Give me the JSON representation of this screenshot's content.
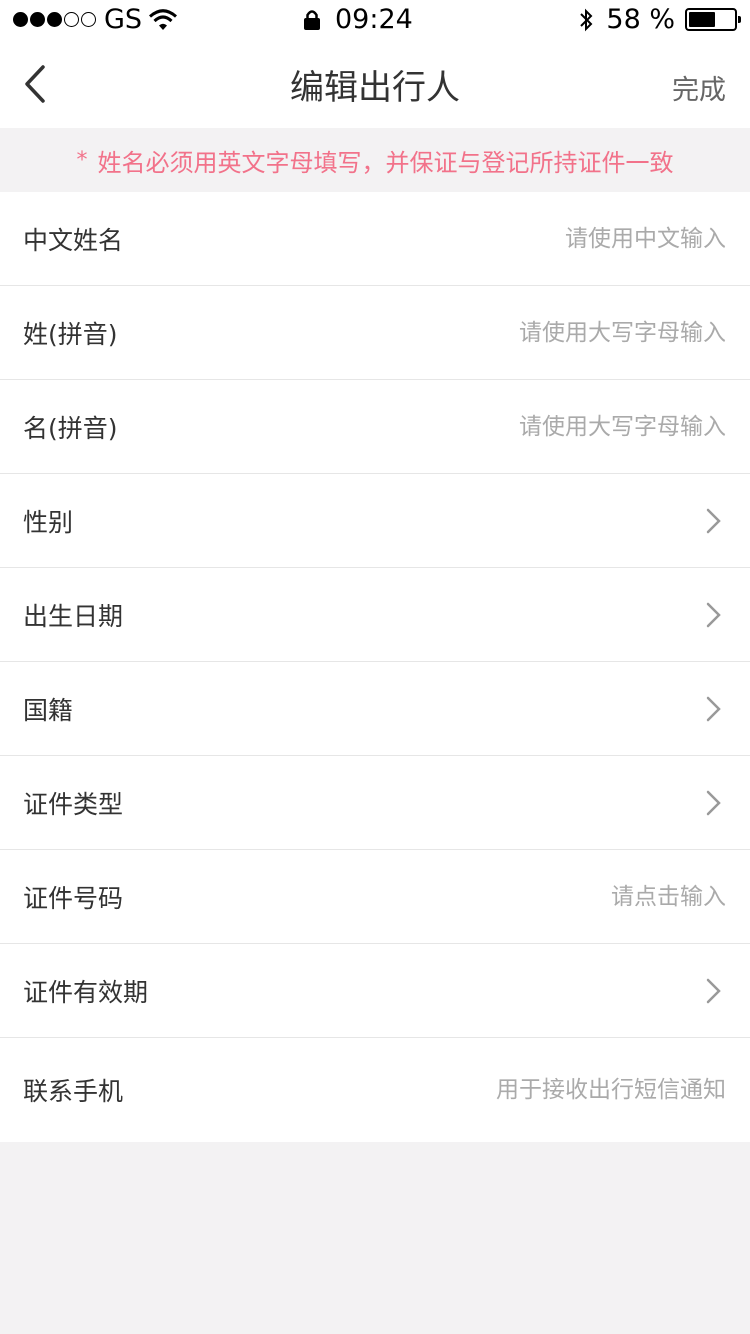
{
  "status_bar": {
    "carrier": "GS",
    "time": "09:24",
    "battery": "58 %",
    "battery_level": 0.58
  },
  "nav": {
    "title": "编辑出行人",
    "done_label": "完成"
  },
  "notice": {
    "star": "*",
    "text": "姓名必须用英文字母填写，并保证与登记所持证件一致"
  },
  "fields": {
    "chinese_name": {
      "label": "中文姓名",
      "placeholder": "请使用中文输入"
    },
    "surname": {
      "label": "姓(拼音)",
      "placeholder": "请使用大写字母输入"
    },
    "given_name": {
      "label": "名(拼音)",
      "placeholder": "请使用大写字母输入"
    },
    "gender": {
      "label": "性别"
    },
    "birth_date": {
      "label": "出生日期"
    },
    "nationality": {
      "label": "国籍"
    },
    "id_type": {
      "label": "证件类型"
    },
    "id_number": {
      "label": "证件号码",
      "placeholder": "请点击输入"
    },
    "id_validity": {
      "label": "证件有效期"
    },
    "phone": {
      "label": "联系手机",
      "placeholder": "用于接收出行短信通知"
    }
  },
  "colors": {
    "notice_text": "#f2728a",
    "background": "#f3f2f3"
  }
}
